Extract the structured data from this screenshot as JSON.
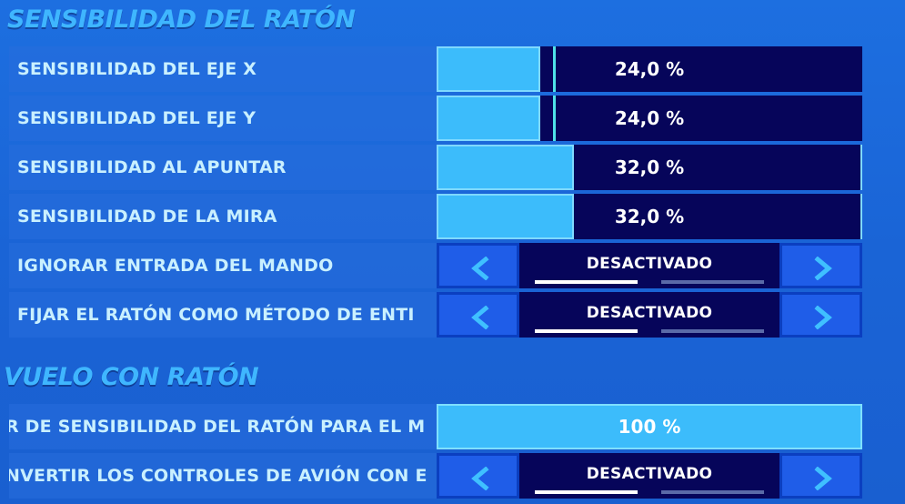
{
  "sections": [
    {
      "title": "SENSIBILIDAD DEL RATÓN",
      "rows": [
        {
          "label": "SENSIBILIDAD DEL EJE X",
          "type": "slider",
          "value": "24,0 %",
          "fill_percent": 24
        },
        {
          "label": "SENSIBILIDAD DEL EJE Y",
          "type": "slider",
          "value": "24,0 %",
          "fill_percent": 24
        },
        {
          "label": "SENSIBILIDAD AL APUNTAR",
          "type": "slider",
          "value": "32,0 %",
          "fill_percent": 32
        },
        {
          "label": "SENSIBILIDAD DE LA MIRA",
          "type": "slider",
          "value": "32,0 %",
          "fill_percent": 32
        },
        {
          "label": "IGNORAR ENTRADA DEL MANDO",
          "type": "selector",
          "value": "DESACTIVADO"
        },
        {
          "label": "FIJAR EL RATÓN COMO MÉTODO DE ENTI",
          "type": "selector",
          "value": "DESACTIVADO"
        }
      ]
    },
    {
      "title": "VUELO CON RATÓN",
      "rows": [
        {
          "label": "R DE SENSIBILIDAD DEL RATÓN PARA EL M",
          "type": "slider",
          "value": "100 %",
          "fill_percent": 100
        },
        {
          "label": "NVERTIR LOS CONTROLES DE AVIÓN CON E",
          "type": "selector",
          "value": "DESACTIVADO"
        }
      ]
    }
  ],
  "colors": {
    "background": "#1d6fe0",
    "title": "#3fb6ff",
    "label": "#c9f0ff",
    "track": "#06055a",
    "fill": "#3cbcfb",
    "marker": "#4fe3e8",
    "arrow_button": "#1f5de8"
  },
  "icons": {
    "prev": "chevron-left-icon",
    "next": "chevron-right-icon"
  }
}
